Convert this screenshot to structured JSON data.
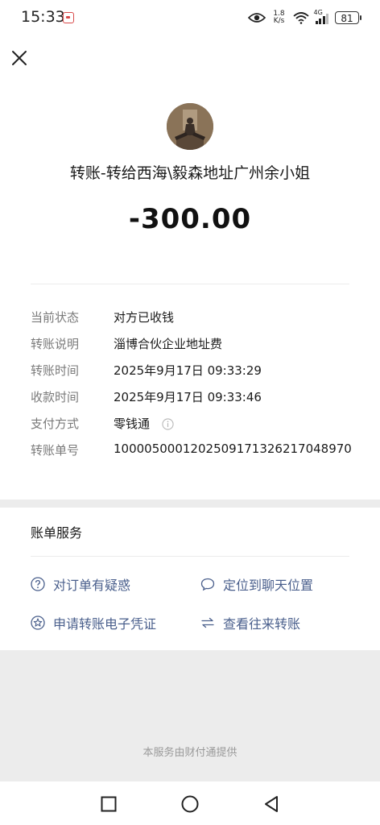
{
  "status_bar": {
    "time": "15:33",
    "net_speed_value": "1.8",
    "net_speed_unit": "K/s",
    "network_type": "4G",
    "battery": "81"
  },
  "transfer": {
    "title": "转账-转给西海\\毅森地址广州余小姐",
    "amount": "-300.00",
    "details": [
      {
        "label": "当前状态",
        "value": "对方已收钱"
      },
      {
        "label": "转账说明",
        "value": "淄博合伙企业地址费"
      },
      {
        "label": "转账时间",
        "value": "2025年9月17日 09:33:29"
      },
      {
        "label": "收款时间",
        "value": "2025年9月17日 09:33:46"
      },
      {
        "label": "支付方式",
        "value": "零钱通"
      },
      {
        "label": "转账单号",
        "value": "1000050001202509171326217048970"
      }
    ]
  },
  "services": {
    "title": "账单服务",
    "items": [
      {
        "label": "对订单有疑惑",
        "icon": "question-circle-icon"
      },
      {
        "label": "定位到聊天位置",
        "icon": "chat-bubble-icon"
      },
      {
        "label": "申请转账电子凭证",
        "icon": "star-badge-icon"
      },
      {
        "label": "查看往来转账",
        "icon": "swap-arrows-icon"
      }
    ]
  },
  "footer": {
    "note": "本服务由财付通提供"
  },
  "colors": {
    "link": "#4a5f8c",
    "label_gray": "#7a7a7a",
    "page_background": "#ececec"
  }
}
